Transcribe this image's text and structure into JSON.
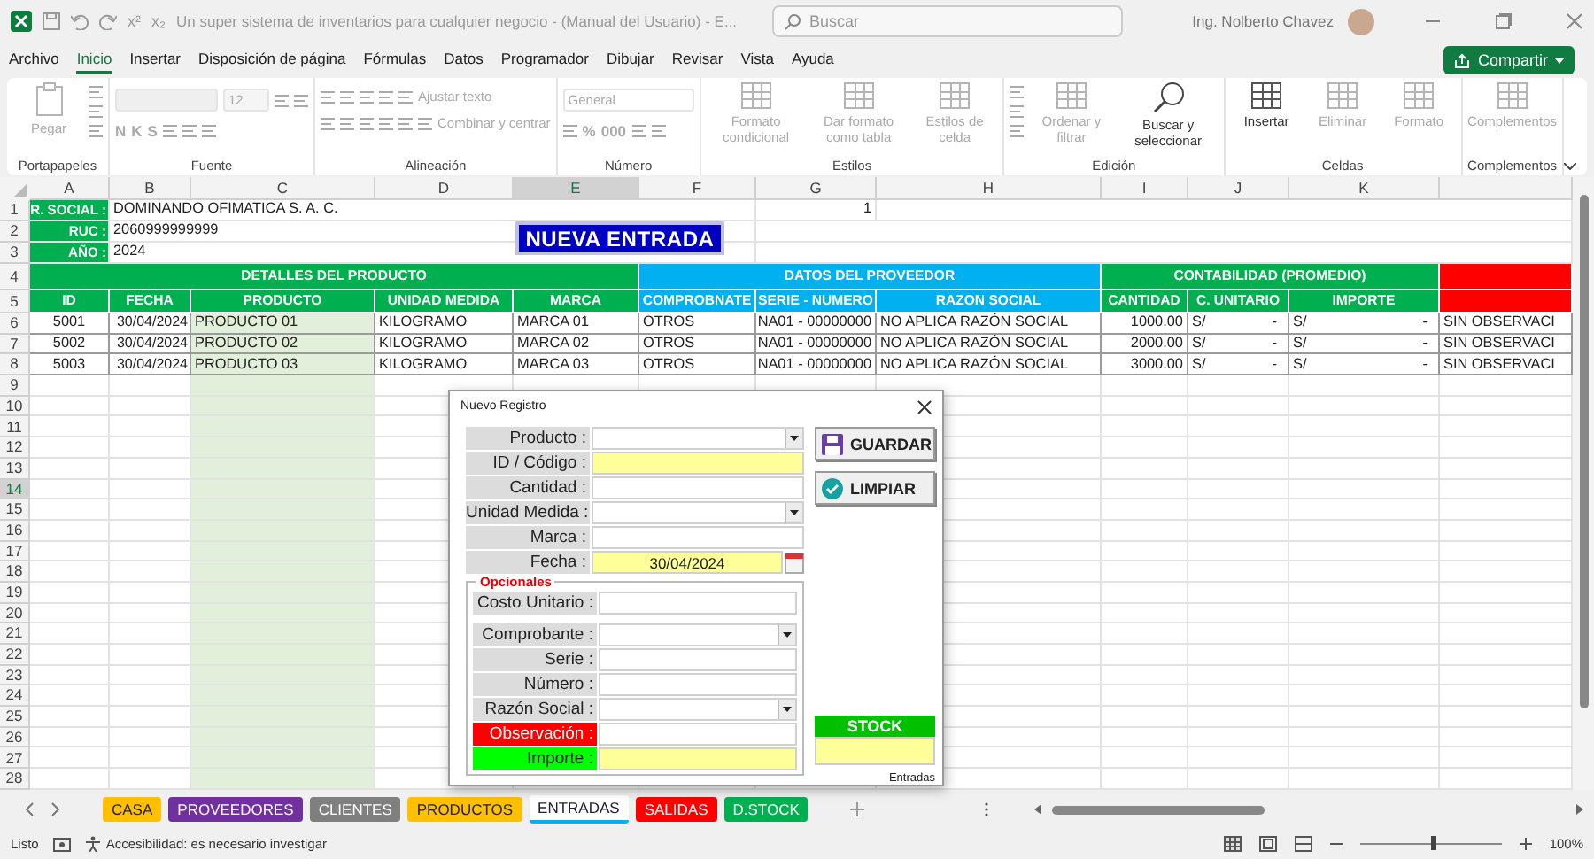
{
  "window": {
    "title": "Un super sistema de inventarios para cualquier negocio - (Manual del Usuario) - E...",
    "quick_access": [
      "x²",
      "x₂"
    ],
    "search_placeholder": "Buscar",
    "user": "Ing. Nolberto Chavez"
  },
  "menu": [
    {
      "label": "Archivo",
      "selected": false
    },
    {
      "label": "Inicio",
      "selected": true
    },
    {
      "label": "Insertar",
      "selected": false
    },
    {
      "label": "Disposición de página",
      "selected": false
    },
    {
      "label": "Fórmulas",
      "selected": false
    },
    {
      "label": "Datos",
      "selected": false
    },
    {
      "label": "Programador",
      "selected": false
    },
    {
      "label": "Dibujar",
      "selected": false
    },
    {
      "label": "Revisar",
      "selected": false
    },
    {
      "label": "Vista",
      "selected": false
    },
    {
      "label": "Ayuda",
      "selected": false
    }
  ],
  "share_button": "Compartir",
  "ribbon": [
    {
      "label": "Portapapeles",
      "items": [
        {
          "kind": "paste",
          "text": "Pegar",
          "disabled": true
        },
        {
          "kind": "tools"
        }
      ]
    },
    {
      "label": "Fuente",
      "items": [
        {
          "kind": "stack",
          "rows": [
            [
              {
                "kind": "fontbox",
                "disabled": true
              },
              {
                "kind": "sizebox",
                "value": "12",
                "disabled": true
              },
              {
                "kind": "icon"
              },
              {
                "kind": "icon"
              }
            ],
            [
              {
                "kind": "glyph",
                "text": "N",
                "disabled": true
              },
              {
                "kind": "glyph",
                "text": "K",
                "disabled": true
              },
              {
                "kind": "glyph",
                "text": "S",
                "disabled": true
              },
              {
                "kind": "icon"
              },
              {
                "kind": "icon"
              },
              {
                "kind": "icon"
              }
            ]
          ]
        }
      ]
    },
    {
      "label": "Alineación",
      "items": [
        {
          "kind": "stack",
          "rows": [
            [
              {
                "kind": "icon"
              },
              {
                "kind": "icon"
              },
              {
                "kind": "icon"
              },
              {
                "kind": "icon"
              },
              {
                "kind": "text",
                "text": "Ajustar texto",
                "disabled": true
              }
            ],
            [
              {
                "kind": "icon"
              },
              {
                "kind": "icon"
              },
              {
                "kind": "icon"
              },
              {
                "kind": "icon"
              },
              {
                "kind": "icon"
              },
              {
                "kind": "text",
                "text": "Combinar y centrar",
                "disabled": true
              }
            ]
          ]
        }
      ]
    },
    {
      "label": "Número",
      "items": [
        {
          "kind": "stack",
          "rows": [
            [
              {
                "kind": "formatbox",
                "value": "General",
                "disabled": true
              }
            ],
            [
              {
                "kind": "icon"
              },
              {
                "kind": "glyph",
                "text": "%",
                "disabled": true
              },
              {
                "kind": "glyph",
                "text": "000",
                "disabled": true
              },
              {
                "kind": "icon"
              },
              {
                "kind": "icon"
              }
            ]
          ]
        }
      ]
    },
    {
      "label": "Estilos",
      "items": [
        {
          "kind": "large",
          "text": "Formato condicional",
          "disabled": true
        },
        {
          "kind": "large",
          "text": "Dar formato como tabla",
          "disabled": true
        },
        {
          "kind": "large",
          "text": "Estilos de celda",
          "disabled": true
        }
      ]
    },
    {
      "label": "Edición",
      "items": [
        {
          "kind": "tools"
        },
        {
          "kind": "large",
          "text": "Ordenar y filtrar",
          "disabled": true
        },
        {
          "kind": "search",
          "text": "Buscar y seleccionar",
          "disabled": false
        }
      ]
    },
    {
      "label": "Celdas",
      "items": [
        {
          "kind": "large",
          "text": "Insertar",
          "disabled": false
        },
        {
          "kind": "large",
          "text": "Eliminar",
          "disabled": true
        },
        {
          "kind": "large",
          "text": "Formato",
          "disabled": true
        }
      ]
    },
    {
      "label": "Complementos",
      "items": [
        {
          "kind": "large",
          "text": "Complementos",
          "disabled": true
        }
      ]
    }
  ],
  "sheet": {
    "column_headers": [
      {
        "label": "A",
        "selected": false
      },
      {
        "label": "B",
        "selected": false
      },
      {
        "label": "C",
        "selected": false
      },
      {
        "label": "D",
        "selected": false
      },
      {
        "label": "E",
        "selected": true
      },
      {
        "label": "F",
        "selected": false
      },
      {
        "label": "G",
        "selected": false
      },
      {
        "label": "H",
        "selected": false
      },
      {
        "label": "I",
        "selected": false
      },
      {
        "label": "J",
        "selected": false
      },
      {
        "label": "K",
        "selected": false
      }
    ],
    "row_headers": [
      {
        "label": "1",
        "selected": false
      },
      {
        "label": "2",
        "selected": false
      },
      {
        "label": "3",
        "selected": false
      },
      {
        "label": "4",
        "selected": false
      },
      {
        "label": "5",
        "selected": false
      },
      {
        "label": "6",
        "selected": false
      },
      {
        "label": "7",
        "selected": false
      },
      {
        "label": "8",
        "selected": false
      },
      {
        "label": "9",
        "selected": false
      },
      {
        "label": "10",
        "selected": false
      },
      {
        "label": "11",
        "selected": false
      },
      {
        "label": "12",
        "selected": false
      },
      {
        "label": "13",
        "selected": false
      },
      {
        "label": "14",
        "selected": true
      },
      {
        "label": "15",
        "selected": false
      },
      {
        "label": "16",
        "selected": false
      },
      {
        "label": "17",
        "selected": false
      },
      {
        "label": "18",
        "selected": false
      },
      {
        "label": "19",
        "selected": false
      },
      {
        "label": "20",
        "selected": false
      },
      {
        "label": "21",
        "selected": false
      },
      {
        "label": "22",
        "selected": false
      },
      {
        "label": "23",
        "selected": false
      },
      {
        "label": "24",
        "selected": false
      },
      {
        "label": "25",
        "selected": false
      },
      {
        "label": "26",
        "selected": false
      },
      {
        "label": "27",
        "selected": false
      },
      {
        "label": "28",
        "selected": false
      }
    ],
    "company": [
      {
        "label": "R. SOCIAL :",
        "value": "DOMINANDO OFIMATICA S. A. C."
      },
      {
        "label": "RUC :",
        "value": "2060999999999"
      },
      {
        "label": "AÑO :",
        "value": "2024"
      }
    ],
    "counter": "1",
    "title_button": "NUEVA ENTRADA",
    "groups": [
      {
        "label": "DETALLES DEL PRODUCTO",
        "color": "#00b050"
      },
      {
        "label": "DATOS DEL PROVEEDOR",
        "color": "#00b0f0"
      },
      {
        "label": "CONTABILIDAD (PROMEDIO)",
        "color": "#00b050"
      },
      {
        "color": "#ff0000"
      }
    ],
    "headers": [
      "ID",
      "FECHA",
      "PRODUCTO",
      "UNIDAD MEDIDA",
      "MARCA",
      "COMPROBNATE",
      "SERIE - NUMERO",
      "RAZON SOCIAL",
      "CANTIDAD",
      "C. UNITARIO",
      "IMPORTE"
    ],
    "rows": [
      {
        "cells": [
          "5001",
          "30/04/2024",
          "PRODUCTO 01",
          "KILOGRAMO",
          "MARCA 01",
          "OTROS",
          "NA01 - 00000000",
          "NO APLICA RAZÓN SOCIAL",
          "1000.00",
          {
            "symbol": "S/",
            "amount": "-"
          },
          {
            "symbol": "S/",
            "amount": "-"
          },
          "SIN OBSERVACI"
        ]
      },
      {
        "cells": [
          "5002",
          "30/04/2024",
          "PRODUCTO 02",
          "KILOGRAMO",
          "MARCA 02",
          "OTROS",
          "NA01 - 00000000",
          "NO APLICA RAZÓN SOCIAL",
          "2000.00",
          {
            "symbol": "S/",
            "amount": "-"
          },
          {
            "symbol": "S/",
            "amount": "-"
          },
          "SIN OBSERVACI"
        ]
      },
      {
        "cells": [
          "5003",
          "30/04/2024",
          "PRODUCTO 03",
          "KILOGRAMO",
          "MARCA 03",
          "OTROS",
          "NA01 - 00000000",
          "NO APLICA RAZÓN SOCIAL",
          "3000.00",
          {
            "symbol": "S/",
            "amount": "-"
          },
          {
            "symbol": "S/",
            "amount": "-"
          },
          "SIN OBSERVACI"
        ]
      }
    ]
  },
  "dialog": {
    "title": "Nuevo Registro",
    "fields": [
      {
        "label": "Producto :",
        "kind": "combo",
        "highlighted": false
      },
      {
        "label": "ID / Código :",
        "kind": "text",
        "highlighted": true
      },
      {
        "label": "Cantidad :",
        "kind": "text",
        "highlighted": false
      },
      {
        "label": "Unidad Medida :",
        "kind": "combo",
        "highlighted": false
      },
      {
        "label": "Marca :",
        "kind": "text",
        "highlighted": false
      },
      {
        "label": "Fecha :",
        "kind": "date",
        "highlighted": true,
        "value": "30/04/2024"
      }
    ],
    "optional": {
      "title": "Opcionales",
      "fields": [
        {
          "label": "Costo Unitario :",
          "kind": "text",
          "highlighted": false
        },
        {
          "label": "Comprobante :",
          "kind": "combo",
          "highlighted": false
        },
        {
          "label": "Serie :",
          "kind": "text",
          "highlighted": false
        },
        {
          "label": "Número :",
          "kind": "text",
          "highlighted": false
        },
        {
          "label": "Razón Social :",
          "kind": "combo",
          "highlighted": false
        },
        {
          "label": "Observación :",
          "kind": "text",
          "highlighted": false,
          "color": "#ff0000"
        },
        {
          "label": "Importe :",
          "kind": "text",
          "highlighted": true,
          "color": "#00ff00"
        }
      ]
    },
    "buttons": [
      {
        "label": "GUARDAR",
        "kind": "save"
      },
      {
        "label": "LIMPIAR",
        "kind": "clear"
      }
    ],
    "stock": "STOCK",
    "footer": "Entradas"
  },
  "sheet_tabs": [
    {
      "label": "CASA",
      "color": "#ffc000",
      "selected": false
    },
    {
      "label": "PROVEEDORES",
      "color": "#7030a0",
      "selected": false
    },
    {
      "label": "CLIENTES",
      "color": "#7f7f7f",
      "selected": false
    },
    {
      "label": "PRODUCTOS",
      "color": "#ffc000",
      "selected": false
    },
    {
      "label": "ENTRADAS",
      "color": "#00b0f0",
      "selected": true
    },
    {
      "label": "SALIDAS",
      "color": "#ff0000",
      "selected": false
    },
    {
      "label": "D.STOCK",
      "color": "#00b050",
      "selected": false
    }
  ],
  "status_bar": {
    "mode": "Listo",
    "accessibility": "Accesibilidad: es necesario investigar",
    "zoom": "100%",
    "zoom_slider": {
      "level": 0.5
    }
  }
}
